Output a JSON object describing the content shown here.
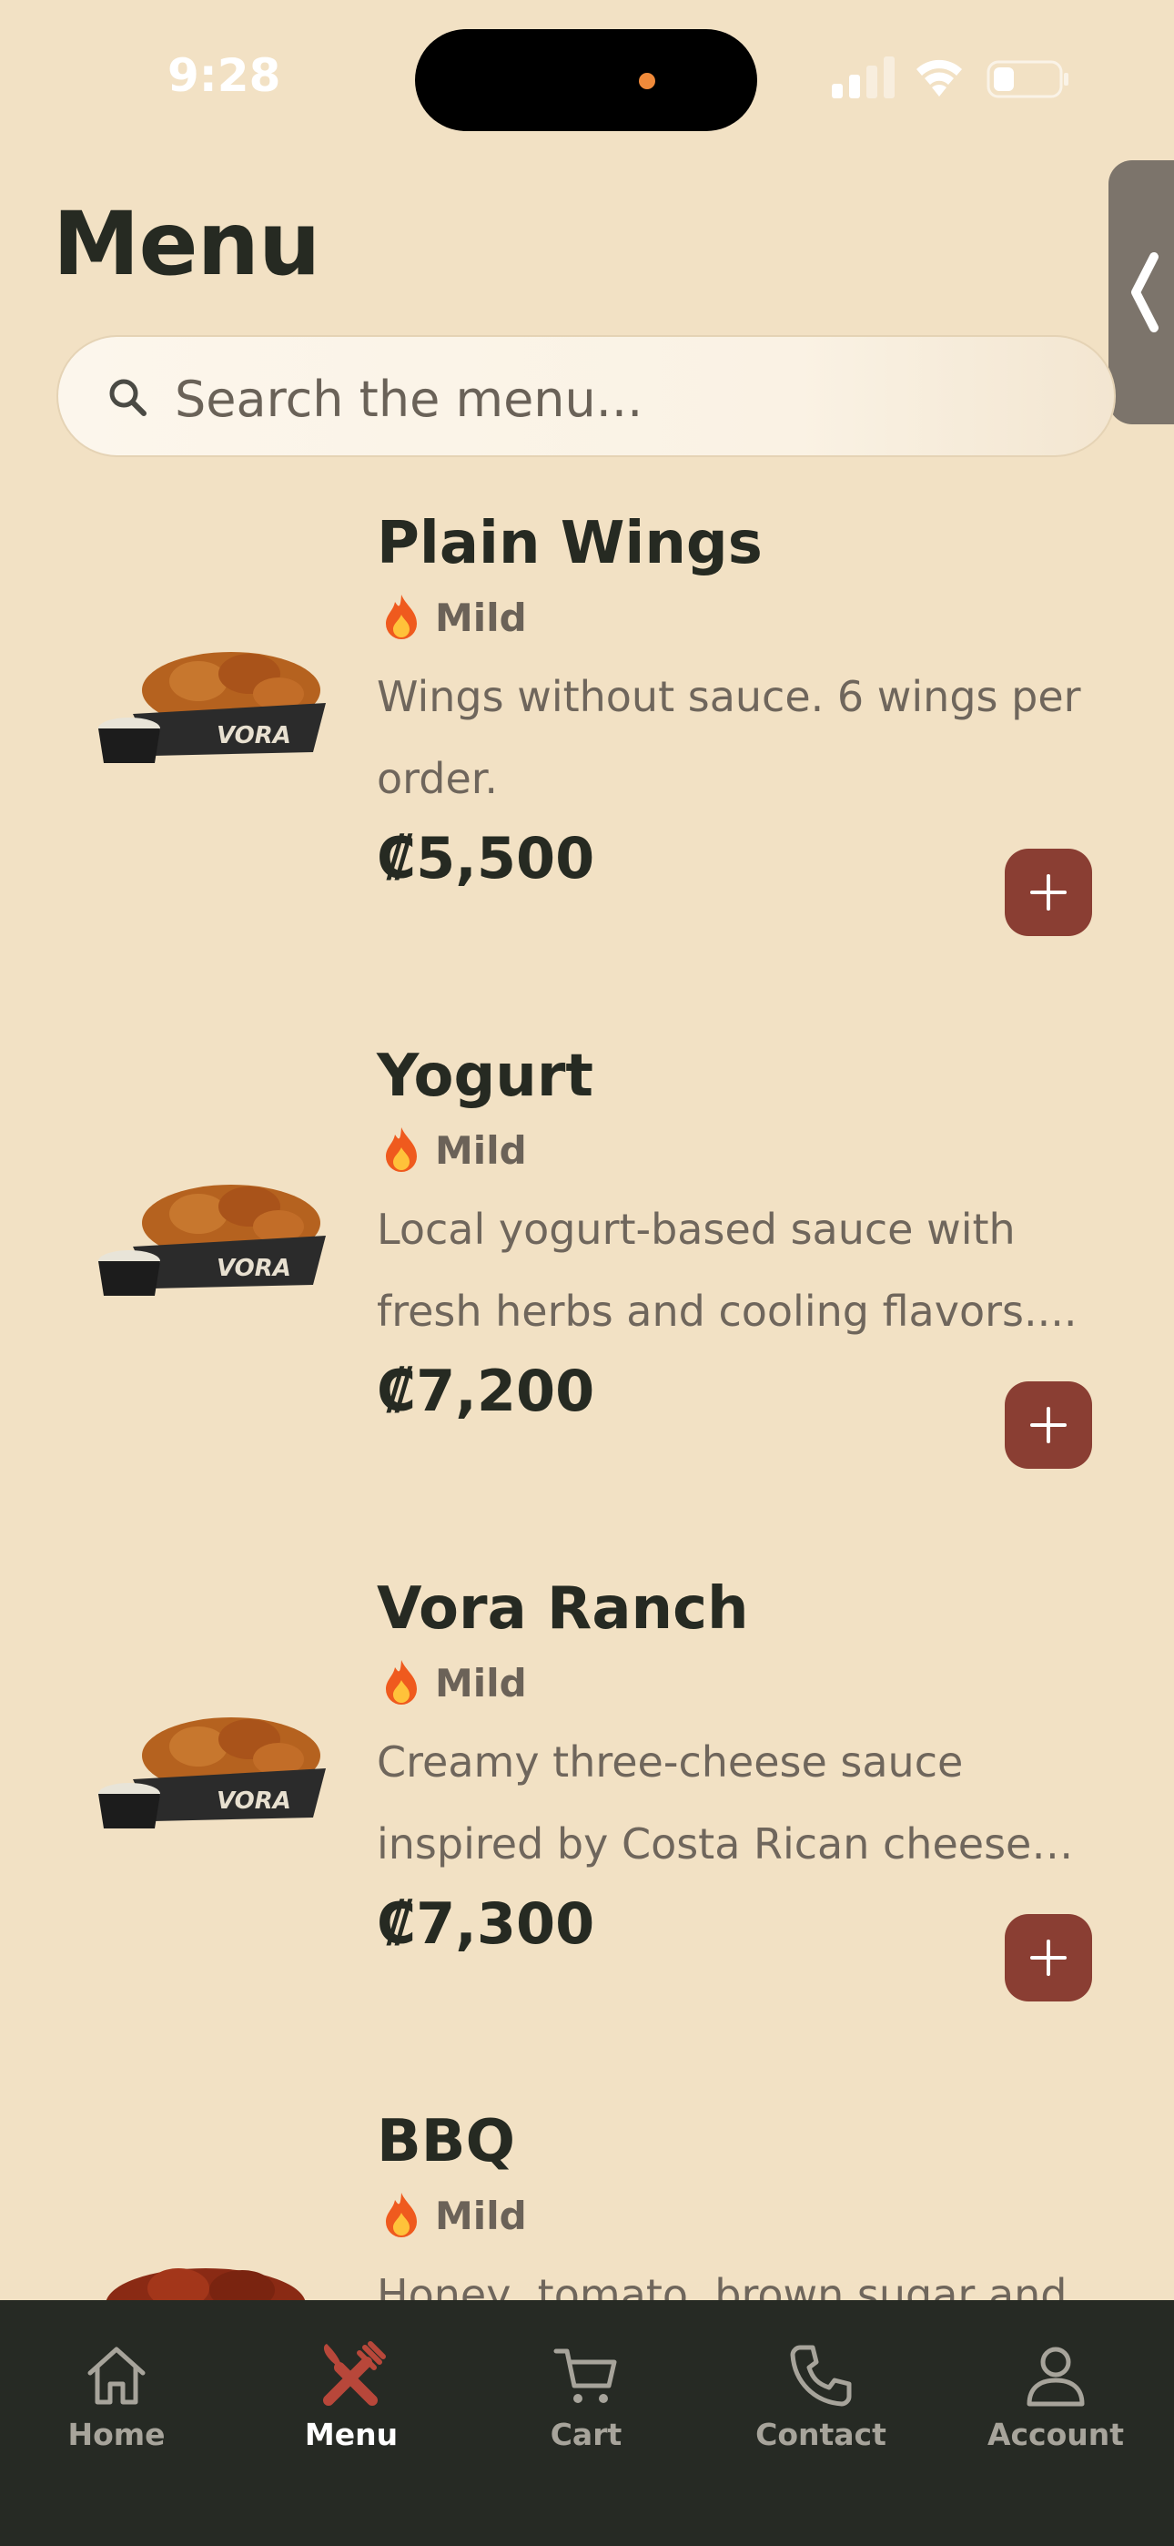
{
  "status_bar": {
    "time": "9:28"
  },
  "header": {
    "title": "Menu"
  },
  "search": {
    "placeholder": "Search the menu..."
  },
  "menu_items": [
    {
      "name": "Plain Wings",
      "heat": "Mild",
      "description": "Wings without sauce. 6 wings per order.",
      "price": "₡5,500"
    },
    {
      "name": "Yogurt",
      "heat": "Mild",
      "description": "Local yogurt-based sauce with fresh herbs and cooling flavors....",
      "price": "₡7,200"
    },
    {
      "name": "Vora Ranch",
      "heat": "Mild",
      "description": "Creamy three-cheese sauce inspired by Costa Rican cheese c...",
      "price": "₡7,300"
    },
    {
      "name": "BBQ",
      "heat": "Mild",
      "description": "Honey, tomato, brown sugar and"
    }
  ],
  "tab_bar": {
    "items": [
      {
        "label": "Home",
        "icon": "home-icon"
      },
      {
        "label": "Menu",
        "icon": "fork-knife-icon",
        "active": true
      },
      {
        "label": "Cart",
        "icon": "cart-icon"
      },
      {
        "label": "Contact",
        "icon": "phone-icon"
      },
      {
        "label": "Account",
        "icon": "user-icon"
      }
    ]
  },
  "colors": {
    "background": "#f2e1c4",
    "accent": "#8a3e33",
    "text": "#262a22",
    "tab_bar": "#262a24"
  }
}
